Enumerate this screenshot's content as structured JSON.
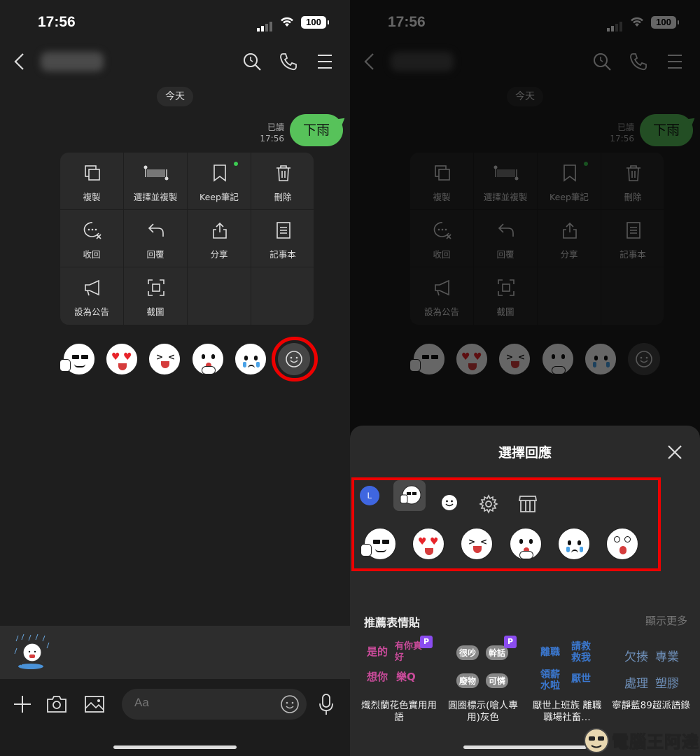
{
  "status": {
    "time": "17:56",
    "battery": "100"
  },
  "chat": {
    "date_chip": "今天",
    "read_label": "已讀",
    "msg_time": "17:56",
    "message": "下雨"
  },
  "menu": {
    "items": [
      {
        "label": "複製",
        "icon": "copy-icon"
      },
      {
        "label": "選擇並複製",
        "icon": "select-copy-icon"
      },
      {
        "label": "Keep筆記",
        "icon": "bookmark-icon"
      },
      {
        "label": "刪除",
        "icon": "trash-icon"
      },
      {
        "label": "收回",
        "icon": "unsend-icon"
      },
      {
        "label": "回覆",
        "icon": "reply-icon"
      },
      {
        "label": "分享",
        "icon": "share-icon"
      },
      {
        "label": "記事本",
        "icon": "note-icon"
      },
      {
        "label": "設為公告",
        "icon": "megaphone-icon"
      },
      {
        "label": "截圖",
        "icon": "screenshot-icon"
      }
    ]
  },
  "input": {
    "placeholder": "Aa"
  },
  "sheet": {
    "title": "選擇回應",
    "avatar_letter": "L",
    "rec_title": "推薦表情貼",
    "rec_more": "顯示更多",
    "recs": [
      {
        "label": "熾烈蘭花色實用用語",
        "badge": "P",
        "words": [
          "是的",
          "有你真好",
          "想你",
          "樂Q"
        ]
      },
      {
        "label": "圓圈標示(嗆人專用)灰色",
        "badge": "P",
        "words": [
          "很吵",
          "幹話",
          "廢物",
          "可憐"
        ]
      },
      {
        "label": "厭世上班族 離職 職場社畜…",
        "badge": "",
        "words": [
          "離職",
          "請救救我",
          "領薪水啦",
          "厭世"
        ]
      },
      {
        "label": "寧靜藍89超派語錄",
        "badge": "",
        "words": [
          "欠揍",
          "專業",
          "處理",
          "塑膠"
        ]
      }
    ]
  },
  "watermark": "電腦王阿達"
}
